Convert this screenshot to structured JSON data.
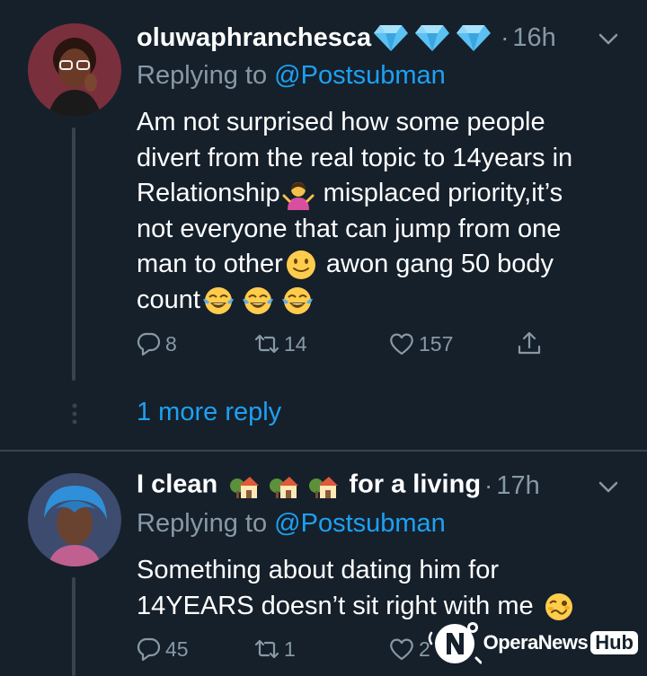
{
  "tweets": [
    {
      "name": "oluwaphranchesca",
      "name_badges": [
        "blue-diamond",
        "blue-diamond",
        "blue-diamond"
      ],
      "separator": "·",
      "time": "16h",
      "replying_prefix": "Replying to ",
      "replying_handle": "@Postsubman",
      "lines": [
        "Am not surprised how some people",
        "divert from the real topic to 14years in",
        "Relationship",
        " misplaced priority,it’s",
        "not everyone that can jump from one",
        "man to other",
        " awon gang 50 body",
        "count"
      ],
      "emojis": [
        "person-shrugging",
        "slightly-smiling-face",
        "tears-of-joy",
        "tears-of-joy",
        "tears-of-joy"
      ],
      "replies": "8",
      "retweets": "14",
      "likes": "157",
      "more_replies": "1 more reply"
    },
    {
      "name_part1": "I clean",
      "name_part2": "for a living",
      "name_emojis": [
        "house-with-garden",
        "house-with-garden",
        "house-with-garden"
      ],
      "separator": "·",
      "time": "17h",
      "replying_prefix": "Replying to ",
      "replying_handle": "@Postsubman",
      "lines": [
        "Something about dating him for",
        "14YEARS doesn’t sit right with me"
      ],
      "emojis": [
        "woozy-face"
      ],
      "replies": "45",
      "retweets": "1",
      "likes": "2"
    }
  ],
  "watermark": {
    "text": "OperaNews",
    "badge": "Hub"
  },
  "colors": {
    "background": "#15202b",
    "secondary_text": "#8899a6",
    "link": "#1da1f2",
    "divider": "#38444d"
  }
}
